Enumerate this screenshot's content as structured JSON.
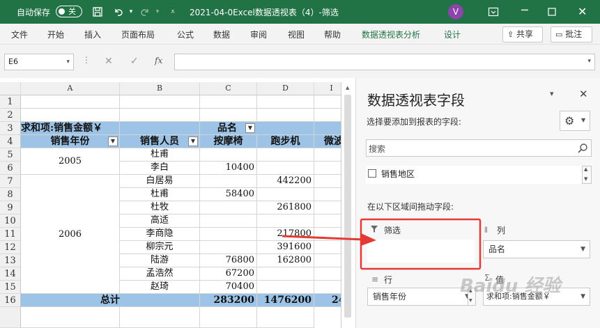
{
  "titlebar": {
    "autosave_label": "自动保存",
    "autosave_state": "关",
    "doc_title": "2021-04-0Excel数据透视表（4）-筛选",
    "avatar_initial": "V"
  },
  "menu": [
    "文件",
    "开始",
    "插入",
    "页面布局",
    "公式",
    "数据",
    "审阅",
    "视图",
    "帮助",
    "数据透视表分析",
    "设计"
  ],
  "share_label": "共享",
  "comment_label": "批注",
  "formula": {
    "namebox": "E6",
    "fx": "fx",
    "value": ""
  },
  "columns": [
    "A",
    "B",
    "C",
    "D",
    "I"
  ],
  "rows": [
    "1",
    "2",
    "3",
    "4",
    "5",
    "6",
    "7",
    "8",
    "9",
    "10",
    "11",
    "12",
    "13",
    "14",
    "15",
    "16"
  ],
  "pivot": {
    "value_header": "求和项:销售金额￥",
    "col_field": "品名",
    "row_header_year": "销售年份",
    "row_header_person": "销售人员",
    "col_items": [
      "按摩椅",
      "跑步机",
      "微波"
    ],
    "years": [
      "2005",
      "2006"
    ],
    "people": [
      "杜甫",
      "李白",
      "白居易",
      "杜甫",
      "杜牧",
      "高适",
      "李商隐",
      "柳宗元",
      "陆游",
      "孟浩然",
      "赵琦"
    ],
    "c_values": [
      "",
      "10400",
      "",
      "58400",
      "",
      "",
      "",
      "",
      "76800",
      "67200",
      "70400"
    ],
    "d_values": [
      "",
      "",
      "442200",
      "",
      "261800",
      "",
      "217800",
      "391600",
      "162800",
      "",
      ""
    ],
    "total_label": "总计",
    "total_c": "283200",
    "total_d": "1476200",
    "total_e": "24"
  },
  "panel": {
    "title": "数据透视表字段",
    "subtitle": "选择要添加到报表的字段:",
    "search_placeholder": "搜索",
    "field_item": "销售地区",
    "drag_hint": "在以下区域间拖动字段:",
    "filter_label": "筛选",
    "columns_label": "列",
    "rows_label": "行",
    "values_label": "值",
    "columns_value": "品名",
    "rows_value": "销售年份",
    "values_value": "求和项:销售金额￥"
  },
  "watermark": "Baidu 经验",
  "colors": {
    "excel_green": "#217346",
    "pivot_blue": "#9dc3e6",
    "highlight_red": "#e53935"
  }
}
